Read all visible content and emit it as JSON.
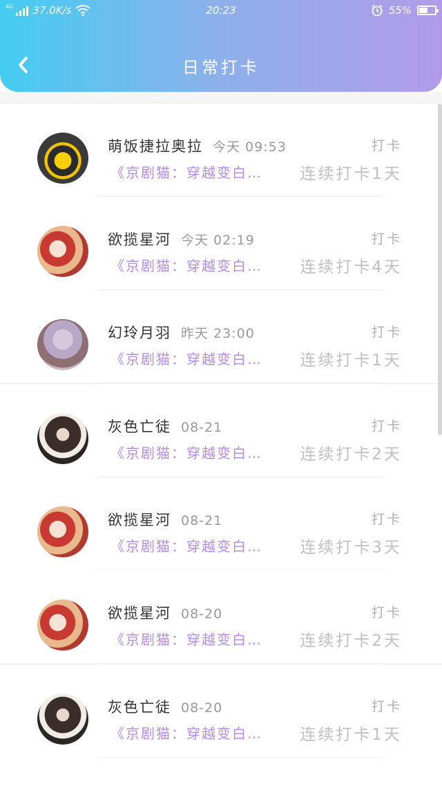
{
  "status_bar": {
    "network": "4G",
    "speed": "37.0K/s",
    "time": "20:23",
    "battery": "55%",
    "battery_level": 0.55
  },
  "header": {
    "title": "日常打卡",
    "back_icon": "chevron-left-icon"
  },
  "colors": {
    "gradient_start": "#43cdf1",
    "gradient_end": "#b19be9",
    "course_text": "#b58be8",
    "muted_text": "#c0c0c0"
  },
  "checkins": [
    {
      "name": "萌饭捷拉奥拉",
      "time": "今天 09:53",
      "label": "打卡",
      "course": "《京剧猫：穿越变白…",
      "streak": "连续打卡1天"
    },
    {
      "name": "欲揽星河",
      "time": "今天 02:19",
      "label": "打卡",
      "course": "《京剧猫：穿越变白…",
      "streak": "连续打卡4天"
    },
    {
      "name": "幻玲月羽",
      "time": "昨天 23:00",
      "label": "打卡",
      "course": "《京剧猫：穿越变白…",
      "streak": "连续打卡1天"
    },
    {
      "name": "灰色亡徒",
      "time": "08-21",
      "label": "打卡",
      "course": "《京剧猫：穿越变白…",
      "streak": "连续打卡2天"
    },
    {
      "name": "欲揽星河",
      "time": "08-21",
      "label": "打卡",
      "course": "《京剧猫：穿越变白…",
      "streak": "连续打卡3天"
    },
    {
      "name": "欲揽星河",
      "time": "08-20",
      "label": "打卡",
      "course": "《京剧猫：穿越变白…",
      "streak": "连续打卡2天"
    },
    {
      "name": "灰色亡徒",
      "time": "08-20",
      "label": "打卡",
      "course": "《京剧猫：穿越变白…",
      "streak": "连续打卡1天"
    }
  ]
}
